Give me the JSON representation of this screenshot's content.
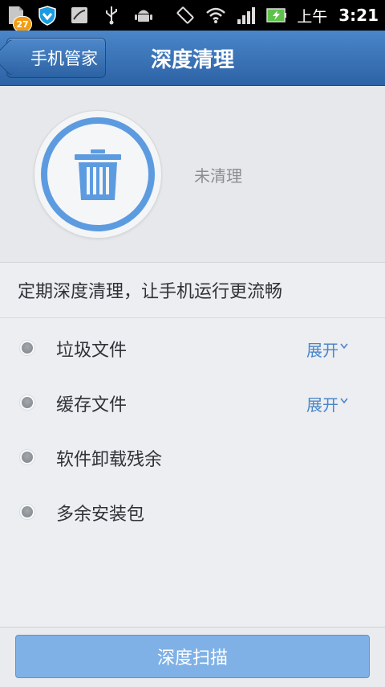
{
  "status_bar": {
    "notification_badge": "27",
    "ampm": "上午",
    "time": "3:21",
    "icons": [
      "app-notification-icon",
      "shield-icon",
      "signal-app-icon",
      "usb-icon",
      "android-icon",
      "rotation-icon",
      "wifi-icon",
      "cell-signal-icon",
      "battery-charging-icon"
    ]
  },
  "header": {
    "back_label": "手机管家",
    "title": "深度清理"
  },
  "hero": {
    "status": "未清理"
  },
  "tagline": "定期深度清理，让手机运行更流畅",
  "items": [
    {
      "label": "垃圾文件",
      "action": "展开"
    },
    {
      "label": "缓存文件",
      "action": "展开"
    },
    {
      "label": "软件卸载残余",
      "action": ""
    },
    {
      "label": "多余安装包",
      "action": ""
    }
  ],
  "footer": {
    "scan_label": "深度扫描"
  },
  "colors": {
    "accent": "#4a86c9",
    "ring": "#5d9be0",
    "button": "#7fb1e6"
  }
}
